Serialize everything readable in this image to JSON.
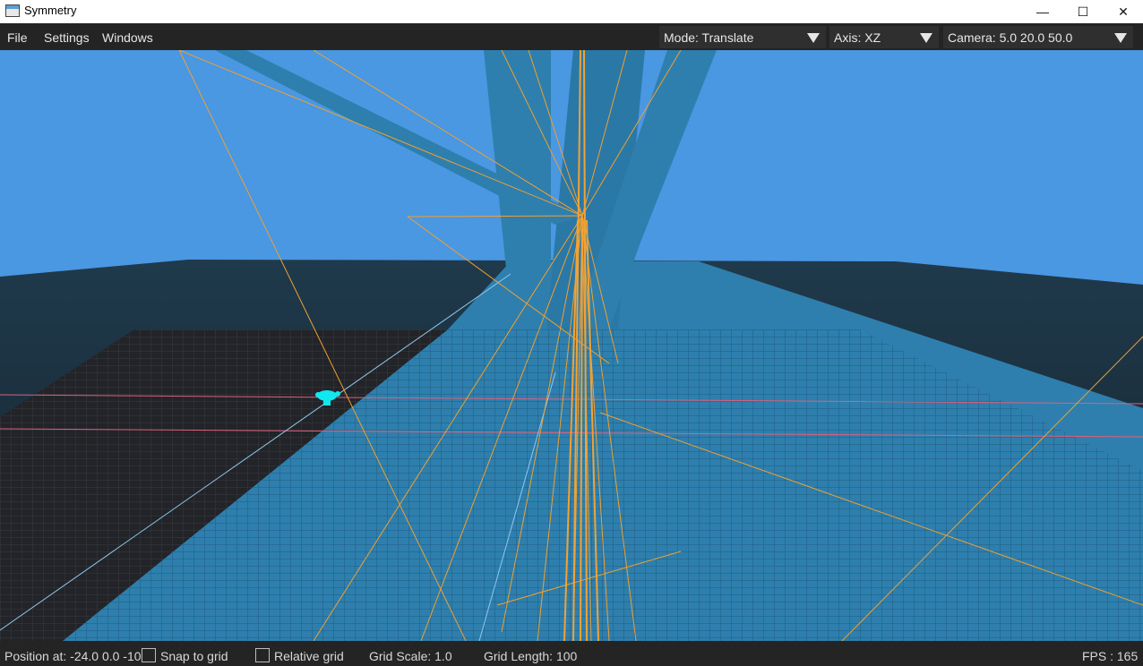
{
  "window": {
    "title": "Symmetry",
    "minimize": "—",
    "maximize": "☐",
    "close": "✕"
  },
  "menubar": {
    "items": [
      "File",
      "Settings",
      "Windows"
    ],
    "mode": "Mode: Translate",
    "axis": "Axis: XZ",
    "camera": "Camera: 5.0  20.0  50.0"
  },
  "statusbar": {
    "position": "Position at: -24.0  0.0  -10",
    "snap_to_grid": "Snap to grid",
    "relative_grid": "Relative grid",
    "grid_scale": "Grid Scale: 1.0",
    "grid_length": "Grid Length: 100",
    "fps": "FPS : 165"
  },
  "colors": {
    "sky": "#4a97e2",
    "horizon_dark": "#1b2c38",
    "plane_blue": "#2e7fad",
    "grid_line": "#1f5d82",
    "wireframe": "#f0a030",
    "axis_red": "#e0607a",
    "axis_light_blue": "#8fc8f0",
    "selected_object": "#10e8f0",
    "menu_bg": "#242424",
    "combo_bg": "#2f2f2f"
  },
  "icons": {
    "app": "window-app-icon",
    "dropdown": "triangle-down-icon",
    "object": "monkey-head-icon"
  }
}
